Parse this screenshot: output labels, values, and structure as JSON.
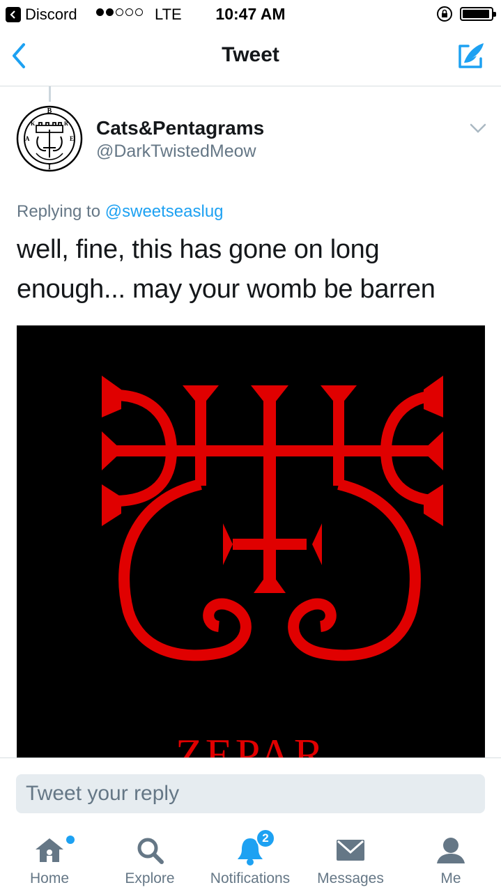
{
  "status_bar": {
    "back_app": "Discord",
    "carrier": "LTE",
    "signal_bars_filled": 2,
    "signal_bars_total": 5,
    "time": "10:47 AM"
  },
  "nav": {
    "title": "Tweet",
    "accent_color": "#1da1f2"
  },
  "tweet": {
    "display_name": "Cats&Pentagrams",
    "handle": "@DarkTwistedMeow",
    "replying_prefix": "Replying to",
    "replying_to": "@sweetseaslug",
    "text": "well, fine, this has gone on long enough... may your womb be barren",
    "media": {
      "caption": "ZEPAR",
      "sigil_color": "#e00000",
      "background": "#000000"
    }
  },
  "reply": {
    "placeholder": "Tweet your reply"
  },
  "tabs": [
    {
      "label": "Home",
      "icon": "home-icon",
      "active": false,
      "has_dot": true
    },
    {
      "label": "Explore",
      "icon": "search-icon",
      "active": false
    },
    {
      "label": "Notifications",
      "icon": "bell-icon",
      "active": true,
      "badge": "2"
    },
    {
      "label": "Messages",
      "icon": "envelope-icon",
      "active": false
    },
    {
      "label": "Me",
      "icon": "person-icon",
      "active": false
    }
  ]
}
